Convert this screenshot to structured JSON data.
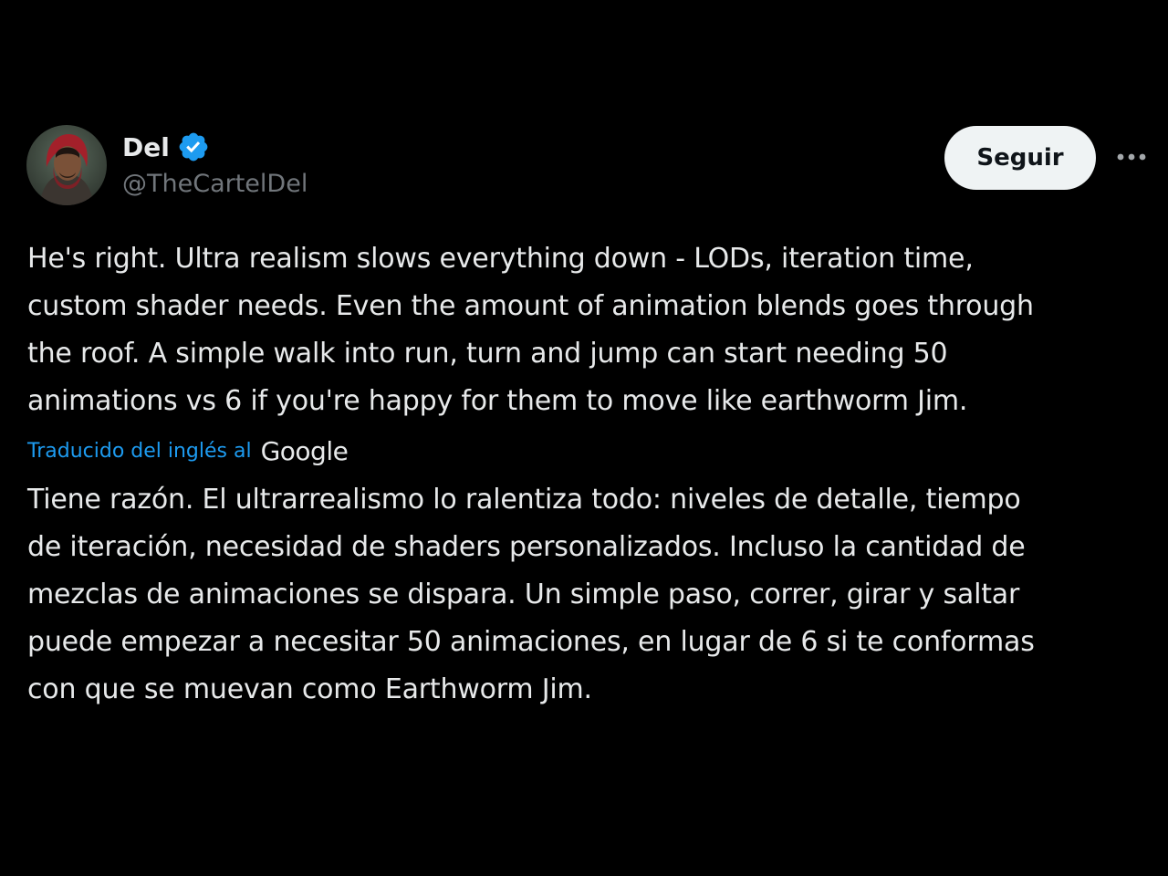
{
  "author": {
    "display_name": "Del",
    "handle": "@TheCartelDel",
    "verified": true,
    "verified_icon": "verified-badge-icon",
    "verified_color": "#1d9bf0"
  },
  "actions": {
    "follow_label": "Seguir",
    "more_icon": "more-horizontal-icon"
  },
  "tweet": {
    "text": "He's right. Ultra realism slows everything down - LODs, iteration time,\ncustom shader needs. Even the amount of animation blends goes through\nthe roof. A simple walk into run, turn and jump can start needing 50\nanimations vs 6 if you're happy for them to move like earthworm Jim.",
    "translated_label": "Traducido del inglés al",
    "translator_logo": "Google",
    "translated_text": "Tiene razón. El ultrarrealismo lo ralentiza todo: niveles de detalle, tiempo\nde iteración, necesidad de shaders personalizados. Incluso la cantidad de\nmezclas de animaciones se dispara. Un simple paso, correr, girar y saltar\npuede empezar a necesitar 50 animaciones, en lugar de 6 si te conformas\ncon que se muevan como Earthworm Jim."
  },
  "colors": {
    "background": "#000000",
    "text": "#e7e9ea",
    "secondary_text": "#71767b",
    "link": "#1d9bf0",
    "follow_button_bg": "#eff3f4"
  }
}
